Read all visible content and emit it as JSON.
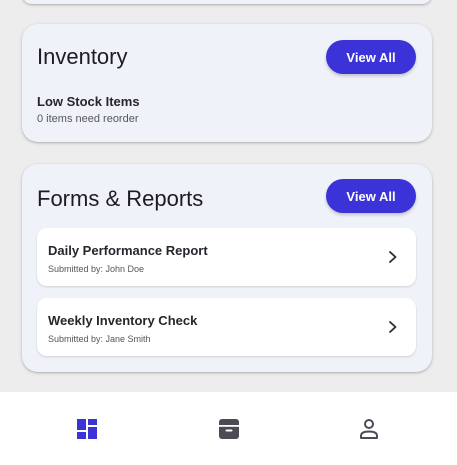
{
  "inventory": {
    "title": "Inventory",
    "view_all_label": "View All",
    "low_stock": {
      "title": "Low Stock Items",
      "subtitle": "0 items need reorder"
    }
  },
  "forms_reports": {
    "title": "Forms & Reports",
    "view_all_label": "View All",
    "items": [
      {
        "title": "Daily Performance Report",
        "subtitle": "Submitted by: John Doe"
      },
      {
        "title": "Weekly Inventory Check",
        "subtitle": "Submitted by: Jane Smith"
      }
    ]
  },
  "bottom_nav": {
    "items": [
      {
        "icon": "dashboard-icon",
        "active": true
      },
      {
        "icon": "archive-box-icon",
        "active": false
      },
      {
        "icon": "person-icon",
        "active": false
      }
    ]
  },
  "colors": {
    "accent": "#3b32d8",
    "active_nav": "#3b32d8",
    "inactive_nav": "#4a4b55",
    "card_background": "#f0f2f9",
    "page_background": "#ededed"
  }
}
